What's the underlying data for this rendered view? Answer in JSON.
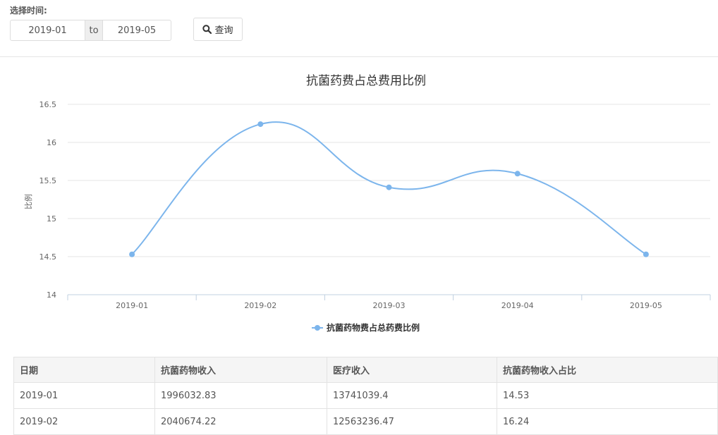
{
  "filter": {
    "label": "选择时间:",
    "start_date": "2019-01",
    "separator": "to",
    "end_date": "2019-05",
    "query_label": "查询"
  },
  "chart_data": {
    "type": "line",
    "title": "抗菌药费占总费用比例",
    "ylabel": "比例",
    "xlabel": "",
    "categories": [
      "2019-01",
      "2019-02",
      "2019-03",
      "2019-04",
      "2019-05"
    ],
    "series": [
      {
        "name": "抗菌药物费占总药费比例",
        "values": [
          14.53,
          16.24,
          15.41,
          15.59,
          14.53
        ]
      }
    ],
    "ylim": [
      14,
      16.5
    ],
    "yticks": [
      "14",
      "14.5",
      "15",
      "15.5",
      "16",
      "16.5"
    ],
    "smooth": true,
    "grid": true,
    "legend_position": "bottom",
    "color": "#7cb5ec"
  },
  "table": {
    "headers": [
      "日期",
      "抗菌药物收入",
      "医疗收入",
      "抗菌药物收入占比"
    ],
    "rows": [
      [
        "2019-01",
        "1996032.83",
        "13741039.4",
        "14.53"
      ],
      [
        "2019-02",
        "2040674.22",
        "12563236.47",
        "16.24"
      ]
    ]
  }
}
